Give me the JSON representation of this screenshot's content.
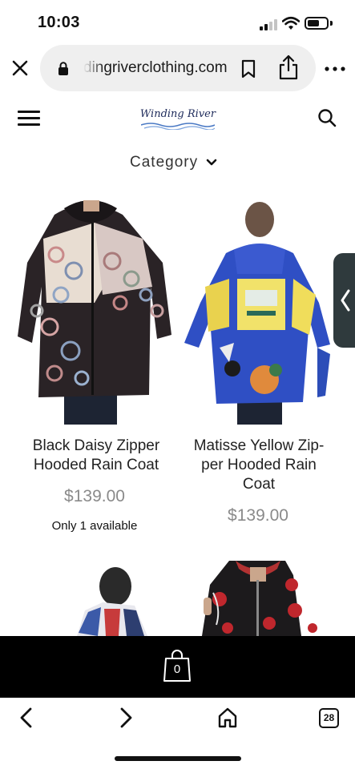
{
  "status_bar": {
    "time": "10:03"
  },
  "browser": {
    "url": "dingriverclothing.com",
    "tabs_count": "28"
  },
  "site": {
    "logo_text": "Winding River",
    "category_label": "Category"
  },
  "products": [
    {
      "title": "Black Daisy Zipper Hooded Rain Coat",
      "price": "$139.00",
      "stock": "Only 1 available",
      "image": "black-floral-rain-coat-photo"
    },
    {
      "title": "Matisse Yellow Zip-per Hooded Rain Coat",
      "price": "$139.00",
      "stock": "",
      "image": "blue-yellow-rain-coat-photo"
    },
    {
      "title": "",
      "price": "",
      "stock": "",
      "image": "striped-rain-coat-photo"
    },
    {
      "title": "",
      "price": "",
      "stock": "",
      "image": "black-red-rose-coat-photo"
    }
  ],
  "cart": {
    "count": "0"
  },
  "colors": {
    "cart_bar": "#000000",
    "side_tab": "#2f3a3d",
    "price": "#8a8a8a"
  }
}
